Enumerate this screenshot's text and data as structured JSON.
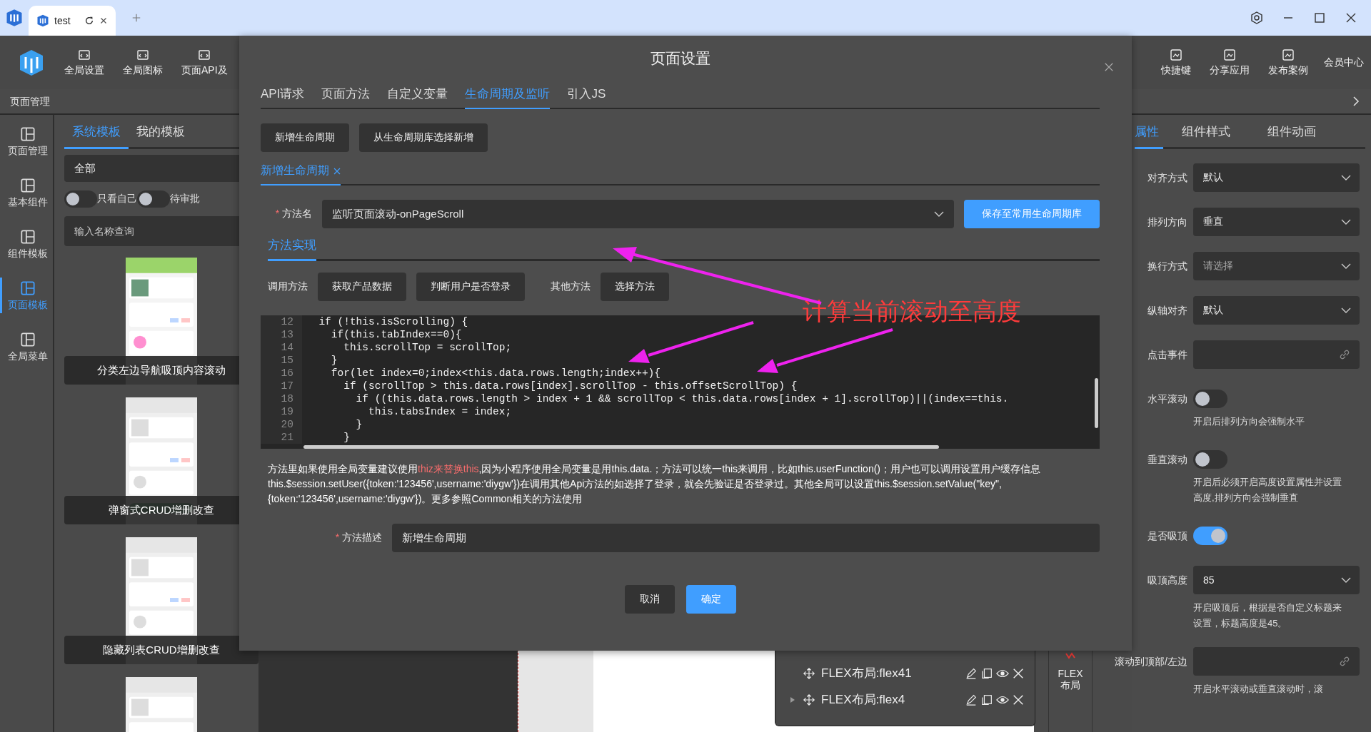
{
  "browser": {
    "tabs": [
      {
        "title": "test",
        "selected": true
      }
    ]
  },
  "header": {
    "tools": [
      {
        "label": "全局设置"
      },
      {
        "label": "全局图标"
      },
      {
        "label": "页面API及"
      }
    ],
    "right_tools": [
      {
        "label": "快捷键"
      },
      {
        "label": "分享应用"
      },
      {
        "label": "发布案例"
      }
    ],
    "member": "会员中心"
  },
  "left": {
    "title": "页面管理",
    "nav": [
      {
        "label": "页面管理",
        "selected": false
      },
      {
        "label": "基本组件",
        "selected": false
      },
      {
        "label": "组件模板",
        "selected": false
      },
      {
        "label": "页面模板",
        "selected": true
      },
      {
        "label": "全局菜单",
        "selected": false
      }
    ],
    "template_tabs": [
      {
        "label": "系统模板",
        "selected": true
      },
      {
        "label": "我的模板",
        "selected": false
      }
    ],
    "category": "全部",
    "toggles": [
      {
        "label": "只看自己",
        "on": false
      },
      {
        "label": "待审批",
        "on": false
      }
    ],
    "search_placeholder": "输入名称查询",
    "templates": [
      {
        "kind": "picture",
        "caption": "分类左边导航吸顶内容滚动"
      },
      {
        "kind": "picture",
        "caption": "弹窗式CRUD增删改查"
      },
      {
        "kind": "picture",
        "caption": "隐藏列表CRUD增删改查"
      },
      {
        "kind": "picture"
      }
    ]
  },
  "modal": {
    "title": "页面设置",
    "tabs": [
      {
        "label": "API请求",
        "selected": false
      },
      {
        "label": "页面方法",
        "selected": false
      },
      {
        "label": "自定义变量",
        "selected": false
      },
      {
        "label": "生命周期及监听",
        "selected": true
      },
      {
        "label": "引入JS",
        "selected": false
      }
    ],
    "actions": [
      "新增生命周期",
      "从生命周期库选择新增"
    ],
    "editor_tabs": [
      {
        "label": "新增生命周期",
        "selected": true
      }
    ],
    "method_name": {
      "mark": "*",
      "label": "方法名",
      "value": "监听页面滚动-onPageScroll"
    },
    "save_button": "保存至常用生命周期库",
    "impl_tabs": [
      {
        "label": "方法实现",
        "selected": true
      }
    ],
    "call_label": "调用方法",
    "call_buttons": [
      "获取产品数据",
      "判断用户是否登录"
    ],
    "other_label": "其他方法",
    "other_button": "选择方法",
    "code": [
      {
        "number": "12",
        "text": "  if (!this.isScrolling) {"
      },
      {
        "number": "13",
        "text": "    if(this.tabIndex==0){"
      },
      {
        "number": "14",
        "text": "      this.scrollTop = scrollTop;"
      },
      {
        "number": "15",
        "text": "    }"
      },
      {
        "number": "16",
        "text": "    for(let index=0;index<this.data.rows.length;index++){"
      },
      {
        "number": "17",
        "text": "      if (scrollTop > this.data.rows[index].scrollTop - this.offsetScrollTop) {"
      },
      {
        "number": "18",
        "text": "        if ((this.data.rows.length > index + 1 && scrollTop < this.data.rows[index + 1].scrollTop)||(index==this."
      },
      {
        "number": "19",
        "text": "          this.tabsIndex = index;"
      },
      {
        "number": "20",
        "text": "        }"
      },
      {
        "number": "21",
        "text": "      }"
      }
    ],
    "help": [
      {
        "text": "方法里如果使用全局变量建议使用",
        "highlight": false
      },
      {
        "text": "thiz来替换this",
        "highlight": true
      },
      {
        "text": ",因为小程序使用全局变量是用this.data.；方法可以统一this来调用，比如this.userFunction()；用户也可以调用设置用户缓存信息this.$session.setUser({token:'123456',username:'diygw'})在调用其他Api方法的如选择了登录，就会先验证是否登录过。其他全局可以设置this.$session.setValue(\"key\",{token:'123456',username:'diygw'})。更多参照Common相关的方法使用",
        "highlight": false
      }
    ],
    "description": {
      "mark": "*",
      "label": "方法描述",
      "value": "新增生命周期"
    },
    "buttons": [
      {
        "label": "取消",
        "kind": "secondary"
      },
      {
        "label": "确定",
        "kind": "primary"
      }
    ]
  },
  "annotation": {
    "text": "计算当前滚动至高度"
  },
  "right_panel": {
    "tabs": [
      {
        "label": "属性",
        "selected": true
      },
      {
        "label": "组件样式",
        "selected": false
      },
      {
        "label": "组件动画",
        "selected": false
      }
    ],
    "fields": [
      {
        "kind": "select",
        "label": "对齐方式",
        "value": "默认"
      },
      {
        "kind": "select",
        "label": "排列方向",
        "value": "垂直"
      },
      {
        "kind": "select",
        "label": "换行方式",
        "placeholder": "请选择"
      },
      {
        "kind": "select",
        "label": "纵轴对齐",
        "value": "默认"
      },
      {
        "kind": "link",
        "label": "点击事件"
      },
      {
        "kind": "switch",
        "label": "水平滚动",
        "on": false,
        "hint": "开启后排列方向会强制水平"
      },
      {
        "kind": "switch",
        "label": "垂直滚动",
        "on": false,
        "hint": "开启后必须开启高度设置属性并设置高度,排列方向会强制垂直"
      },
      {
        "kind": "switch",
        "label": "是否吸顶",
        "on": true
      },
      {
        "kind": "select",
        "label": "吸顶高度",
        "value": "85",
        "hint": "开启吸顶后，根据是否自定义标题来设置，标题高度是45。"
      },
      {
        "kind": "link",
        "label": "滚动到顶部/左边",
        "hint": "开启水平滚动或垂直滚动时，滚"
      }
    ]
  },
  "canvas": {
    "layers": [
      {
        "name": "FLEX布局:flex41",
        "kind": "leaf"
      },
      {
        "name": "FLEX布局:flex4",
        "kind": "group"
      }
    ],
    "toolbar_item": "FLEX布局"
  }
}
